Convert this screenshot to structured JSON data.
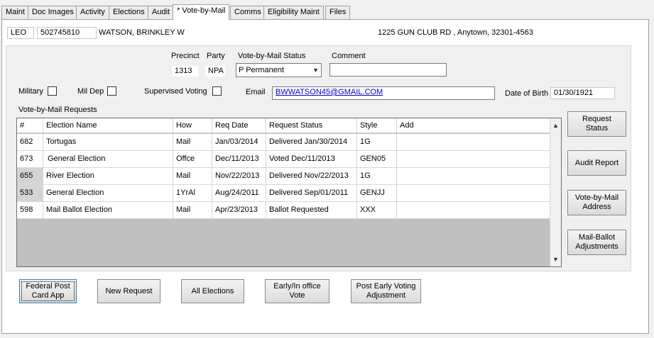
{
  "tabs": [
    {
      "label": "Maint",
      "active": false
    },
    {
      "label": "Doc Images",
      "active": false
    },
    {
      "label": "Activity",
      "active": false
    },
    {
      "label": "Elections",
      "active": false
    },
    {
      "label": "Audit",
      "active": false
    },
    {
      "label": "* Vote-by-Mail",
      "active": true
    },
    {
      "label": "Comms",
      "active": false
    },
    {
      "label": "Eligibility Maint",
      "active": false
    },
    {
      "label": "Files",
      "active": false
    }
  ],
  "voter": {
    "county": "LEO",
    "id": "502745810",
    "name": "WATSON, BRINKLEY W",
    "address": "1225 GUN CLUB RD , Anytown, 32301-4563"
  },
  "labels": {
    "precinct": "Precinct",
    "party": "Party",
    "vbm_status": "Vote-by-Mail Status",
    "comment": "Comment",
    "military": "Military",
    "mil_dep": "Mil Dep",
    "supervised": "Supervised Voting",
    "email": "Email",
    "dob": "Date of Birth",
    "requests_section": "Vote-by-Mail Requests"
  },
  "values": {
    "precinct": "1313",
    "party": "NPA",
    "vbm_status": "P Permanent",
    "comment": "",
    "email": "BWWATSON45@GMAIL.COM",
    "dob": "01/30/1921"
  },
  "grid": {
    "headers": [
      "#",
      "Election Name",
      "How",
      "Req Date",
      "Request Status",
      "Style",
      "Add"
    ],
    "rows": [
      {
        "num": "682",
        "election": "Tortugas",
        "how": "Mail",
        "req_date": "Jan/03/2014",
        "status": "Delivered Jan/30/2014",
        "style": "1G",
        "add": ""
      },
      {
        "num": "673",
        "election": "General Election",
        "how": "Offce",
        "req_date": "Dec/11/2013",
        "status": "Voted Dec/11/2013",
        "style": "GEN05",
        "add": ""
      },
      {
        "num": "655",
        "election": "River Election",
        "how": "Mail",
        "req_date": "Nov/22/2013",
        "status": "Delivered Nov/22/2013",
        "style": "1G",
        "add": ""
      },
      {
        "num": "533",
        "election": "General Election",
        "how": "1YrAl",
        "req_date": "Aug/24/2011",
        "status": "Delivered Sep/01/2011",
        "style": "GENJJ",
        "add": ""
      },
      {
        "num": "598",
        "election": "Mail Ballot Election",
        "how": "Mail",
        "req_date": "Apr/23/2013",
        "status": "Ballot Requested",
        "style": "XXX",
        "add": ""
      }
    ]
  },
  "side_buttons": {
    "request_status": "Request\nStatus",
    "audit_report": "Audit Report",
    "vbm_address": "Vote-by-Mail\nAddress",
    "mail_ballot_adj": "Mail-Ballot\nAdjustments"
  },
  "bottom_buttons": {
    "fpca": "Federal Post\nCard App",
    "new_request": "New Request",
    "all_elections": "All Elections",
    "early_vote": "Early/In office\nVote",
    "post_early": "Post Early Voting\nAdjustment"
  }
}
